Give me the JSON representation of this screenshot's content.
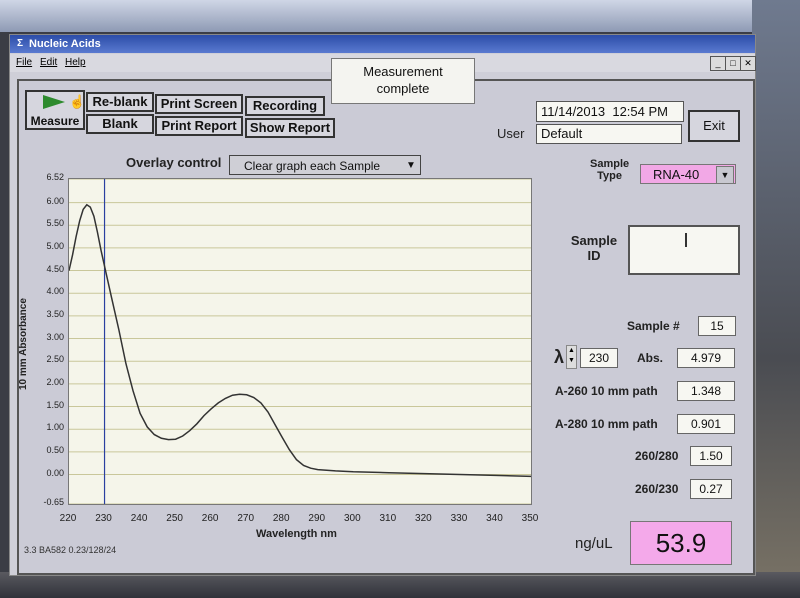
{
  "window": {
    "title": "Nucleic Acids",
    "title_icon": "app-icon",
    "controls": [
      "minimize",
      "maximize",
      "close"
    ]
  },
  "menu": {
    "items": [
      "File",
      "Edit",
      "Help"
    ]
  },
  "toolbar": {
    "measure": "Measure",
    "reblank": "Re-blank",
    "blank": "Blank",
    "print_screen": "Print Screen",
    "print_report": "Print Report",
    "recording": "Recording",
    "show_report": "Show Report"
  },
  "status": {
    "line1": "Measurement",
    "line2": "complete"
  },
  "datetime": {
    "date": "11/14/2013",
    "time": "12:54 PM"
  },
  "user": {
    "label": "User",
    "value": "Default"
  },
  "exit": "Exit",
  "overlay": {
    "label": "Overlay control",
    "selected": "Clear graph each Sample"
  },
  "sample_type": {
    "label_line1": "Sample",
    "label_line2": "Type",
    "value": "RNA-40"
  },
  "sample_id": {
    "label_line1": "Sample",
    "label_line2": "ID",
    "value": ""
  },
  "results": {
    "sample_num_label": "Sample #",
    "sample_num": "15",
    "lambda_symbol": "λ",
    "lambda": "230",
    "abs_label": "Abs.",
    "abs": "4.979",
    "a260_label": "A-260 10 mm path",
    "a260": "1.348",
    "a280_label": "A-280 10 mm path",
    "a280": "0.901",
    "r260280_label": "260/280",
    "r260280": "1.50",
    "r260230_label": "260/230",
    "r260230": "0.27",
    "conc_label": "ng/uL",
    "conc": "53.9"
  },
  "version": "3.3 BA582 0.23/128/24",
  "chart_data": {
    "type": "line",
    "xlabel": "Wavelength nm",
    "ylabel": "10 mm Absorbance",
    "xlim": [
      220,
      350
    ],
    "ylim": [
      -0.65,
      6.52
    ],
    "xticks": [
      "220",
      "230",
      "240",
      "250",
      "260",
      "270",
      "280",
      "290",
      "300",
      "310",
      "320",
      "330",
      "340",
      "350"
    ],
    "yticks": [
      "6.52",
      "6.00",
      "5.50",
      "5.00",
      "4.50",
      "4.00",
      "3.50",
      "3.00",
      "2.50",
      "2.00",
      "1.50",
      "1.00",
      "0.50",
      "0.00",
      "-0.65"
    ],
    "grid": true,
    "cursor_x": 230,
    "series": [
      {
        "x": [
          220,
          221,
          222,
          223,
          224,
          225,
          226,
          227,
          228,
          229,
          230,
          232,
          234,
          236,
          238,
          240,
          242,
          244,
          246,
          248,
          250,
          252,
          254,
          256,
          258,
          260,
          262,
          264,
          266,
          268,
          270,
          272,
          274,
          276,
          278,
          280,
          282,
          284,
          286,
          288,
          290,
          295,
          300,
          310,
          320,
          330,
          340,
          350
        ],
        "y": [
          4.5,
          4.85,
          5.25,
          5.6,
          5.85,
          5.95,
          5.9,
          5.7,
          5.35,
          4.95,
          4.6,
          3.9,
          3.2,
          2.45,
          1.85,
          1.35,
          1.05,
          0.88,
          0.8,
          0.77,
          0.78,
          0.85,
          0.97,
          1.12,
          1.3,
          1.45,
          1.58,
          1.68,
          1.75,
          1.77,
          1.76,
          1.7,
          1.58,
          1.38,
          1.1,
          0.82,
          0.55,
          0.33,
          0.2,
          0.14,
          0.11,
          0.08,
          0.06,
          0.04,
          0.02,
          0.0,
          -0.02,
          -0.04
        ]
      }
    ]
  }
}
